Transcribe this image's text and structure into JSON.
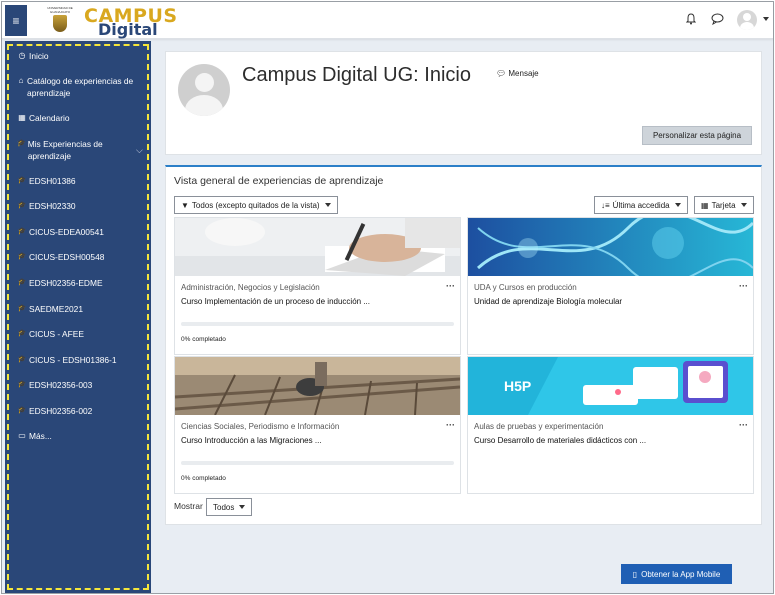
{
  "topbar": {
    "menu_icon": "≡",
    "logo_seal_text": "UNIVERSIDAD DE GUANAJUATO",
    "brand_line1": "CAMPUS",
    "brand_line2": "Digital",
    "icons": [
      "bell-icon",
      "chat-icon",
      "user-avatar",
      "chevron-down-icon"
    ]
  },
  "sidebar": {
    "items": [
      {
        "icon": "◷",
        "label": "Inicio"
      },
      {
        "icon": "⌂",
        "label": "Catálogo de experiencias de aprendizaje"
      },
      {
        "icon": "▦",
        "label": "Calendario"
      },
      {
        "icon": "🎓",
        "label": "Mis Experiencias de aprendizaje"
      },
      {
        "icon": "🎓",
        "label": "EDSH01386"
      },
      {
        "icon": "🎓",
        "label": "EDSH02330"
      },
      {
        "icon": "🎓",
        "label": "CICUS-EDEA00541"
      },
      {
        "icon": "🎓",
        "label": "CICUS-EDSH00548"
      },
      {
        "icon": "🎓",
        "label": "EDSH02356-EDME"
      },
      {
        "icon": "🎓",
        "label": "SAEDME2021"
      },
      {
        "icon": "🎓",
        "label": "CICUS - AFEE"
      },
      {
        "icon": "🎓",
        "label": "CICUS - EDSH01386-1"
      },
      {
        "icon": "🎓",
        "label": "EDSH02356-003"
      },
      {
        "icon": "🎓",
        "label": "EDSH02356-002"
      },
      {
        "icon": "▭",
        "label": "Más..."
      }
    ]
  },
  "header": {
    "title": "Campus Digital UG: Inicio",
    "message_label": "Mensaje",
    "customize_label": "Personalizar esta página"
  },
  "overview": {
    "title": "Vista general de experiencias de aprendizaje",
    "filter_label": "Todos (excepto quitados de la vista)",
    "sort_label": "Última accedida",
    "view_label": "Tarjeta",
    "courses": [
      {
        "category": "Administración, Negocios y Legislación",
        "name": "Curso Implementación de un proceso de inducción ...",
        "progress_text": "0% completado",
        "progress": 0
      },
      {
        "category": "UDA y Cursos en producción",
        "name": "Unidad de aprendizaje Biología molecular",
        "progress_text": "",
        "progress": null
      },
      {
        "category": "Ciencias Sociales, Periodismo e Información",
        "name": "Curso Introducción a las Migraciones ...",
        "progress_text": "0% completado",
        "progress": 0
      },
      {
        "category": "Aulas de pruebas y experimentación",
        "name": "Curso Desarrollo de materiales didácticos con ...",
        "progress_text": "",
        "progress": null
      }
    ],
    "show_label": "Mostrar",
    "show_value": "Todos",
    "h5p_text": "H5P"
  },
  "footer": {
    "app_button": "Obtener la App Mobile"
  },
  "colors": {
    "sidebar": "#2a4778",
    "highlight": "#f5e63a",
    "accent": "#2b7fc8",
    "brand_gold": "#d9a81f"
  }
}
